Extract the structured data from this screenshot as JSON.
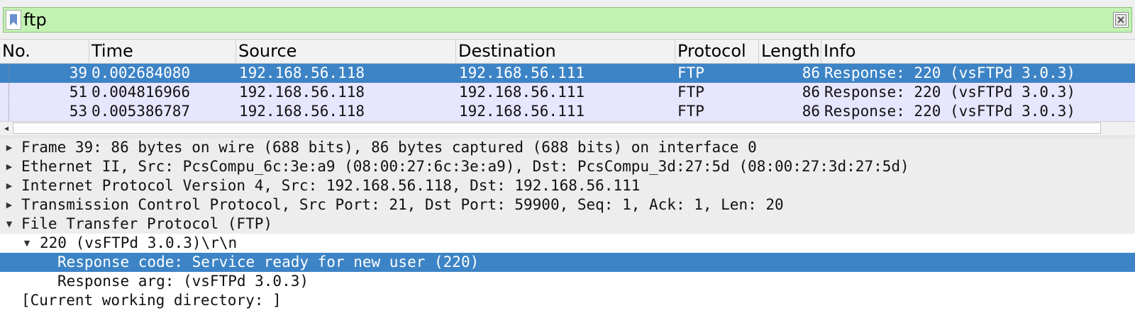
{
  "filter": {
    "value": "ftp",
    "bookmark_icon": "bookmark-icon",
    "clear_icon": "clear-icon",
    "background": "#c2f2b2"
  },
  "packet_list": {
    "columns": [
      "No.",
      "Time",
      "Source",
      "Destination",
      "Protocol",
      "Length",
      "Info"
    ],
    "rows": [
      {
        "no": "39",
        "time": "0.002684080",
        "source": "192.168.56.118",
        "destination": "192.168.56.111",
        "protocol": "FTP",
        "length": "86",
        "info": "Response: 220 (vsFTPd 3.0.3)",
        "selected": true
      },
      {
        "no": "51",
        "time": "0.004816966",
        "source": "192.168.56.118",
        "destination": "192.168.56.111",
        "protocol": "FTP",
        "length": "86",
        "info": "Response: 220 (vsFTPd 3.0.3)",
        "selected": false
      },
      {
        "no": "53",
        "time": "0.005386787",
        "source": "192.168.56.118",
        "destination": "192.168.56.111",
        "protocol": "FTP",
        "length": "86",
        "info": "Response: 220 (vsFTPd 3.0.3)",
        "selected": false
      }
    ],
    "row_color": "#e7e6ff",
    "selected_color": "#3d84c6"
  },
  "details": {
    "items": [
      {
        "text": "Frame 39: 86 bytes on wire (688 bits), 86 bytes captured (688 bits) on interface 0",
        "expander": "collapsed"
      },
      {
        "text": "Ethernet II, Src: PcsCompu_6c:3e:a9 (08:00:27:6c:3e:a9), Dst: PcsCompu_3d:27:5d (08:00:27:3d:27:5d)",
        "expander": "collapsed"
      },
      {
        "text": "Internet Protocol Version 4, Src: 192.168.56.118, Dst: 192.168.56.111",
        "expander": "collapsed"
      },
      {
        "text": "Transmission Control Protocol, Src Port: 21, Dst Port: 59900, Seq: 1, Ack: 1, Len: 20",
        "expander": "collapsed"
      },
      {
        "text": "File Transfer Protocol (FTP)",
        "expander": "expanded"
      },
      {
        "text": "220 (vsFTPd 3.0.3)\\r\\n",
        "expander": "expanded"
      },
      {
        "text": "Response code: Service ready for new user (220)",
        "expander": "none",
        "selected": true
      },
      {
        "text": "Response arg: (vsFTPd 3.0.3)",
        "expander": "none"
      },
      {
        "text": "[Current working directory: ]",
        "expander": "none"
      }
    ]
  }
}
